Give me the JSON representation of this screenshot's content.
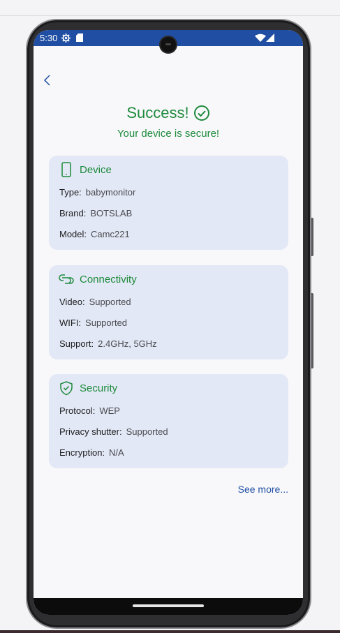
{
  "status_bar": {
    "time": "5:30"
  },
  "header": {
    "title": "Success!",
    "subtitle": "Your device is secure!"
  },
  "colors": {
    "accent_green": "#1e8a3c",
    "status_blue": "#1f4ea3",
    "card_bg": "#e2e8f5"
  },
  "cards": [
    {
      "title": "Device",
      "icon": "phone-icon",
      "rows": [
        {
          "label": "Type:",
          "value": "babymonitor"
        },
        {
          "label": "Brand:",
          "value": "BOTSLAB"
        },
        {
          "label": "Model:",
          "value": "Camc221"
        }
      ]
    },
    {
      "title": "Connectivity",
      "icon": "connectivity-icon",
      "rows": [
        {
          "label": "Video:",
          "value": "Supported"
        },
        {
          "label": "WIFI:",
          "value": "Supported"
        },
        {
          "label": "Support:",
          "value": "2.4GHz, 5GHz"
        }
      ]
    },
    {
      "title": "Security",
      "icon": "shield-check-icon",
      "rows": [
        {
          "label": "Protocol:",
          "value": "WEP"
        },
        {
          "label": "Privacy shutter:",
          "value": "Supported"
        },
        {
          "label": "Encryption:",
          "value": "N/A"
        }
      ]
    }
  ],
  "see_more_label": "See more..."
}
